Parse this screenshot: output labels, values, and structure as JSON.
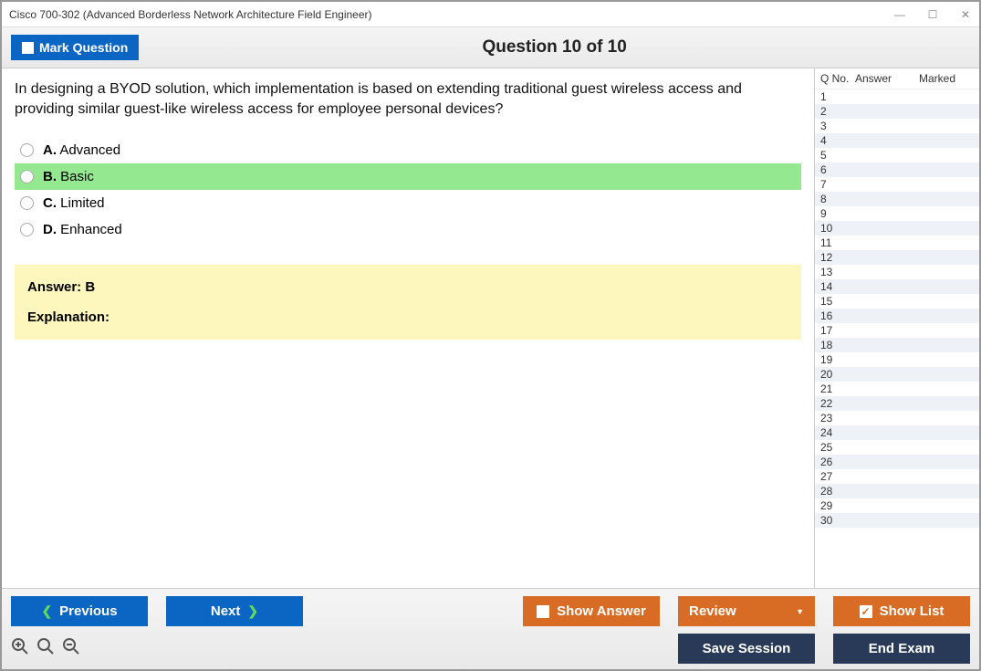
{
  "window": {
    "title": "Cisco 700-302 (Advanced Borderless Network Architecture Field Engineer)"
  },
  "header": {
    "mark_label": "Mark Question",
    "question_title": "Question 10 of 10"
  },
  "question": {
    "text": "In designing a BYOD solution, which implementation is based on extending traditional guest wireless access and providing similar guest-like wireless access for employee personal devices?",
    "options": [
      {
        "letter": "A.",
        "text": "Advanced",
        "correct": false
      },
      {
        "letter": "B.",
        "text": "Basic",
        "correct": true
      },
      {
        "letter": "C.",
        "text": "Limited",
        "correct": false
      },
      {
        "letter": "D.",
        "text": "Enhanced",
        "correct": false
      }
    ],
    "answer_label": "Answer: B",
    "explanation_label": "Explanation:"
  },
  "sidebar": {
    "headers": {
      "qno": "Q No.",
      "answer": "Answer",
      "marked": "Marked"
    },
    "rows": [
      1,
      2,
      3,
      4,
      5,
      6,
      7,
      8,
      9,
      10,
      11,
      12,
      13,
      14,
      15,
      16,
      17,
      18,
      19,
      20,
      21,
      22,
      23,
      24,
      25,
      26,
      27,
      28,
      29,
      30
    ]
  },
  "buttons": {
    "previous": "Previous",
    "next": "Next",
    "show_answer": "Show Answer",
    "review": "Review",
    "show_list": "Show List",
    "save_session": "Save Session",
    "end_exam": "End Exam"
  }
}
